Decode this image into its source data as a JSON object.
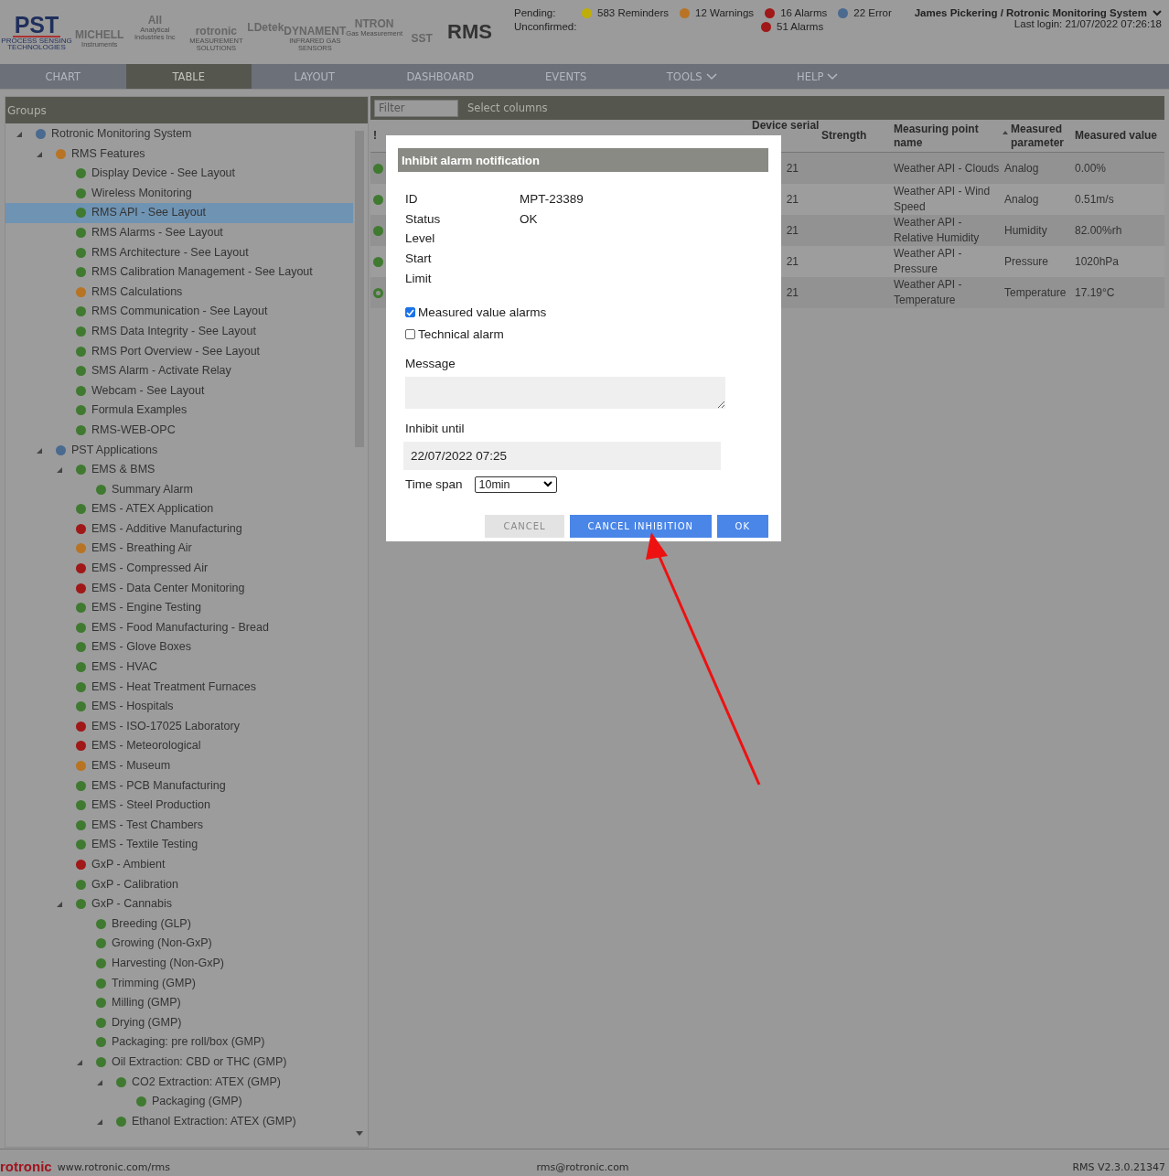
{
  "header": {
    "pst_logo": {
      "name": "PST",
      "line1": "PROCESS SENSING",
      "line2": "TECHNOLOGIES"
    },
    "logos": [
      {
        "name": "MICHELL",
        "sub": "Instruments"
      },
      {
        "name": "AII",
        "sub": "Analytical Industries Inc"
      },
      {
        "name": "rotronic",
        "sub": "MEASUREMENT SOLUTIONS"
      },
      {
        "name": "LDetek"
      },
      {
        "name": "DYNAMENT",
        "sub": "INFRARED GAS SENSORS"
      },
      {
        "name": "NTRON",
        "sub": "Gas Measurement"
      },
      {
        "name": "SST"
      }
    ],
    "app_title": "RMS",
    "pending_label": "Pending:",
    "unconfirmed_label": "Unconfirmed:",
    "pending": [
      {
        "text": "583 Reminders",
        "color": "#bfae0a"
      },
      {
        "text": "12 Warnings",
        "color": "#b87424"
      },
      {
        "text": "16 Alarms",
        "color": "#a01818"
      },
      {
        "text": "22 Error",
        "color": "#4a6a90"
      }
    ],
    "unconfirmed": [
      {
        "text": "51 Alarms",
        "color": "#a01818"
      }
    ],
    "user": "James Pickering / Rotronic Monitoring System",
    "last_login": "Last login: 21/07/2022 07:26:18"
  },
  "nav": [
    {
      "label": "CHART",
      "selected": false,
      "dropdown": false
    },
    {
      "label": "TABLE",
      "selected": true,
      "dropdown": false
    },
    {
      "label": "LAYOUT",
      "selected": false,
      "dropdown": false
    },
    {
      "label": "DASHBOARD",
      "selected": false,
      "dropdown": false
    },
    {
      "label": "EVENTS",
      "selected": false,
      "dropdown": false
    },
    {
      "label": "TOOLS",
      "selected": false,
      "dropdown": true
    },
    {
      "label": "HELP",
      "selected": false,
      "dropdown": true
    }
  ],
  "groups": {
    "title": "Groups",
    "tree": [
      {
        "label": "Rotronic Monitoring System",
        "color": "#4a6a90",
        "selected": false,
        "expanded": true,
        "children": [
          {
            "label": "RMS Features",
            "color": "#b87424",
            "selected": false,
            "expanded": true,
            "children": [
              {
                "label": "Display Device - See Layout",
                "color": "#3f7a30",
                "selected": false
              },
              {
                "label": "Wireless Monitoring",
                "color": "#3f7a30",
                "selected": false
              },
              {
                "label": "RMS API - See Layout",
                "color": "#3f7a30",
                "selected": true
              },
              {
                "label": "RMS Alarms - See Layout",
                "color": "#3f7a30",
                "selected": false
              },
              {
                "label": "RMS Architecture - See Layout",
                "color": "#3f7a30",
                "selected": false
              },
              {
                "label": "RMS Calibration Management - See Layout",
                "color": "#3f7a30",
                "selected": false
              },
              {
                "label": "RMS Calculations",
                "color": "#b87424",
                "selected": false
              },
              {
                "label": "RMS Communication - See Layout",
                "color": "#3f7a30",
                "selected": false
              },
              {
                "label": "RMS Data Integrity - See Layout",
                "color": "#3f7a30",
                "selected": false
              },
              {
                "label": "RMS Port Overview - See Layout",
                "color": "#3f7a30",
                "selected": false
              },
              {
                "label": "SMS Alarm - Activate Relay",
                "color": "#3f7a30",
                "selected": false
              },
              {
                "label": "Webcam - See Layout",
                "color": "#3f7a30",
                "selected": false
              },
              {
                "label": "Formula Examples",
                "color": "#3f7a30",
                "selected": false
              },
              {
                "label": "RMS-WEB-OPC",
                "color": "#3f7a30",
                "selected": false
              }
            ]
          },
          {
            "label": "PST Applications",
            "color": "#4a6a90",
            "selected": false,
            "expanded": true,
            "children": [
              {
                "label": "EMS & BMS",
                "color": "#3f7a30",
                "selected": false,
                "expanded": true,
                "children": [
                  {
                    "label": "Summary Alarm",
                    "color": "#3f7a30",
                    "selected": false
                  }
                ]
              },
              {
                "label": "EMS - ATEX Application",
                "color": "#3f7a30",
                "selected": false
              },
              {
                "label": "EMS - Additive Manufacturing",
                "color": "#a01818",
                "selected": false
              },
              {
                "label": "EMS - Breathing Air",
                "color": "#b87424",
                "selected": false
              },
              {
                "label": "EMS - Compressed Air",
                "color": "#a01818",
                "selected": false
              },
              {
                "label": "EMS - Data Center Monitoring",
                "color": "#a01818",
                "selected": false
              },
              {
                "label": "EMS - Engine Testing",
                "color": "#3f7a30",
                "selected": false
              },
              {
                "label": "EMS - Food Manufacturing - Bread",
                "color": "#3f7a30",
                "selected": false
              },
              {
                "label": "EMS - Glove Boxes",
                "color": "#3f7a30",
                "selected": false
              },
              {
                "label": "EMS - HVAC",
                "color": "#3f7a30",
                "selected": false
              },
              {
                "label": "EMS - Heat Treatment Furnaces",
                "color": "#3f7a30",
                "selected": false
              },
              {
                "label": "EMS - Hospitals",
                "color": "#3f7a30",
                "selected": false
              },
              {
                "label": "EMS - ISO-17025 Laboratory",
                "color": "#a01818",
                "selected": false
              },
              {
                "label": "EMS - Meteorological",
                "color": "#a01818",
                "selected": false
              },
              {
                "label": "EMS - Museum",
                "color": "#b87424",
                "selected": false
              },
              {
                "label": "EMS - PCB Manufacturing",
                "color": "#3f7a30",
                "selected": false
              },
              {
                "label": "EMS - Steel Production",
                "color": "#3f7a30",
                "selected": false
              },
              {
                "label": "EMS - Test Chambers",
                "color": "#3f7a30",
                "selected": false
              },
              {
                "label": "EMS - Textile Testing",
                "color": "#3f7a30",
                "selected": false
              },
              {
                "label": "GxP - Ambient",
                "color": "#a01818",
                "selected": false
              },
              {
                "label": "GxP - Calibration",
                "color": "#3f7a30",
                "selected": false
              },
              {
                "label": "GxP - Cannabis",
                "color": "#3f7a30",
                "selected": false,
                "expanded": true,
                "children": [
                  {
                    "label": "Breeding (GLP)",
                    "color": "#3f7a30",
                    "selected": false
                  },
                  {
                    "label": "Growing (Non-GxP)",
                    "color": "#3f7a30",
                    "selected": false
                  },
                  {
                    "label": "Harvesting (Non-GxP)",
                    "color": "#3f7a30",
                    "selected": false
                  },
                  {
                    "label": "Trimming (GMP)",
                    "color": "#3f7a30",
                    "selected": false
                  },
                  {
                    "label": "Milling (GMP)",
                    "color": "#3f7a30",
                    "selected": false
                  },
                  {
                    "label": "Drying (GMP)",
                    "color": "#3f7a30",
                    "selected": false
                  },
                  {
                    "label": "Packaging: pre roll/box (GMP)",
                    "color": "#3f7a30",
                    "selected": false
                  },
                  {
                    "label": "Oil Extraction: CBD or THC (GMP)",
                    "color": "#3f7a30",
                    "selected": false,
                    "expanded": true,
                    "children": [
                      {
                        "label": "CO2 Extraction: ATEX (GMP)",
                        "color": "#3f7a30",
                        "selected": false,
                        "expanded": true,
                        "children": [
                          {
                            "label": "Packaging (GMP)",
                            "color": "#3f7a30",
                            "selected": false
                          }
                        ]
                      },
                      {
                        "label": "Ethanol Extraction: ATEX (GMP)",
                        "color": "#3f7a30",
                        "selected": false,
                        "expanded": true
                      }
                    ]
                  }
                ]
              }
            ]
          }
        ]
      }
    ]
  },
  "table": {
    "filter_placeholder": "Filter",
    "select_columns": "Select columns",
    "columns": [
      "!",
      "Device serial",
      "Strength",
      "Measuring point name",
      "Measured parameter",
      "Measured value"
    ],
    "rows": [
      {
        "color": "#3f7a30",
        "outlined": false,
        "serial": "21",
        "measuring_point": "Weather API - Clouds",
        "parameter": "Analog",
        "value": "0.00%"
      },
      {
        "color": "#3f7a30",
        "outlined": false,
        "serial": "21",
        "measuring_point": "Weather API - Wind Speed",
        "parameter": "Analog",
        "value": "0.51m/s"
      },
      {
        "color": "#3f7a30",
        "outlined": false,
        "serial": "21",
        "measuring_point": "Weather API - Relative Humidity",
        "parameter": "Humidity",
        "value": "82.00%rh"
      },
      {
        "color": "#3f7a30",
        "outlined": false,
        "serial": "21",
        "measuring_point": "Weather API - Pressure",
        "parameter": "Pressure",
        "value": "1020hPa"
      },
      {
        "color": "#3f7a30",
        "outlined": true,
        "serial": "21",
        "measuring_point": "Weather API - Temperature",
        "parameter": "Temperature",
        "value": "17.19°C"
      }
    ]
  },
  "dialog": {
    "title": "Inhibit alarm notification",
    "fields": [
      {
        "label": "ID",
        "value": "MPT-23389"
      },
      {
        "label": "Status",
        "value": "OK"
      },
      {
        "label": "Level"
      },
      {
        "label": "Start"
      },
      {
        "label": "Limit"
      }
    ],
    "checkboxes": [
      {
        "label": "Measured value alarms",
        "checked": true
      },
      {
        "label": "Technical alarm",
        "checked": false
      }
    ],
    "message_label": "Message",
    "inhibit_label": "Inhibit until",
    "inhibit_value": "22/07/2022 07:25",
    "timespan_label": "Time span",
    "timespan_value": "10min",
    "buttons": [
      {
        "label": "CANCEL",
        "kind": "secondary"
      },
      {
        "label": "CANCEL INHIBITION",
        "kind": "primary"
      },
      {
        "label": "OK",
        "kind": "primary"
      }
    ]
  },
  "footer": {
    "logo": "rotronic",
    "website": "www.rotronic.com/rms",
    "email": "rms@rotronic.com",
    "version": "RMS V2.3.0.21347"
  }
}
